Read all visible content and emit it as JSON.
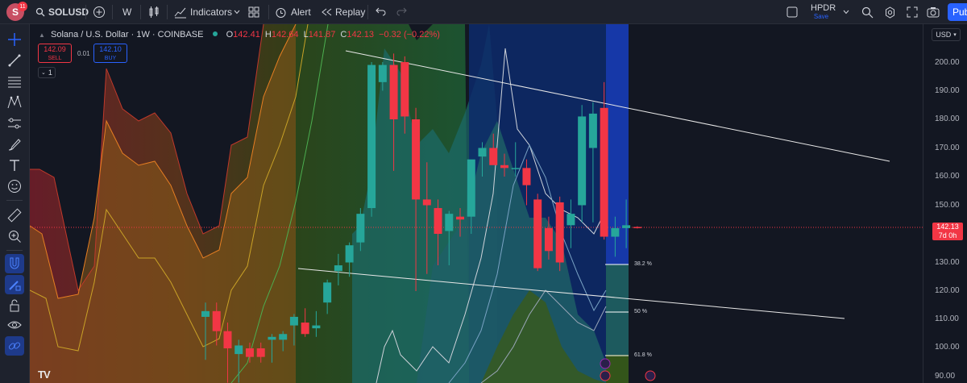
{
  "header": {
    "avatar_letter": "S",
    "notification_count": "11",
    "symbol": "SOLUSD",
    "interval": "W",
    "indicators_label": "Indicators",
    "alert_label": "Alert",
    "replay_label": "Replay",
    "layout_name": "HPDR",
    "layout_status": "Save",
    "publish_label": "Pub"
  },
  "legend": {
    "title": "Solana / U.S. Dollar · 1W · COINBASE",
    "o_label": "O",
    "o_value": "142.41",
    "h_label": "H",
    "h_value": "142.64",
    "l_label": "L",
    "l_value": "141.87",
    "c_label": "C",
    "c_value": "142.13",
    "change": "−0.32 (−0.22%)"
  },
  "trade": {
    "sell_price": "142.09",
    "sell_label": "SELL",
    "spread": "0.01",
    "buy_price": "142.10",
    "buy_label": "BUY",
    "indicator_count": "1"
  },
  "axis": {
    "currency": "USD",
    "ticks": [
      "200.00",
      "190.00",
      "180.00",
      "170.00",
      "160.00",
      "150.00",
      "130.00",
      "120.00",
      "110.00",
      "100.00",
      "90.00"
    ],
    "last_price": "142.13",
    "countdown": "7d 0h"
  },
  "fib_levels": [
    "38.2 %",
    "50 %",
    "61.8 %"
  ],
  "logo": "TV",
  "colors": {
    "background": "#131722",
    "up": "#26a69a",
    "down": "#f23645",
    "accent": "#2962ff"
  },
  "candles": [
    {
      "o": 111,
      "h": 116,
      "l": 96,
      "c": 113
    },
    {
      "o": 113,
      "h": 116,
      "l": 101,
      "c": 106
    },
    {
      "o": 106,
      "h": 109,
      "l": 88,
      "c": 100
    },
    {
      "o": 98,
      "h": 103,
      "l": 88,
      "c": 101
    },
    {
      "o": 100,
      "h": 102,
      "l": 95,
      "c": 97
    },
    {
      "o": 100,
      "h": 102,
      "l": 95,
      "c": 97
    },
    {
      "o": 103,
      "h": 105,
      "l": 95,
      "c": 104
    },
    {
      "o": 103,
      "h": 106,
      "l": 99,
      "c": 105
    },
    {
      "o": 108,
      "h": 112,
      "l": 101,
      "c": 111
    },
    {
      "o": 109,
      "h": 114,
      "l": 104,
      "c": 105
    },
    {
      "o": 107,
      "h": 113,
      "l": 104,
      "c": 108
    },
    {
      "o": 116,
      "h": 124,
      "l": 112,
      "c": 123
    },
    {
      "o": 127,
      "h": 133,
      "l": 122,
      "c": 129
    },
    {
      "o": 130,
      "h": 137,
      "l": 125,
      "c": 136
    },
    {
      "o": 137,
      "h": 149,
      "l": 134,
      "c": 147
    },
    {
      "o": 149,
      "h": 200,
      "l": 146,
      "c": 199
    },
    {
      "o": 193,
      "h": 200,
      "l": 190,
      "c": 199
    },
    {
      "o": 199,
      "h": 203,
      "l": 162,
      "c": 180
    },
    {
      "o": 200,
      "h": 202,
      "l": 175,
      "c": 181
    },
    {
      "o": 180,
      "h": 184,
      "l": 120,
      "c": 152
    },
    {
      "o": 152,
      "h": 165,
      "l": 126,
      "c": 150
    },
    {
      "o": 149,
      "h": 152,
      "l": 129,
      "c": 140
    },
    {
      "o": 141,
      "h": 148,
      "l": 129,
      "c": 147
    },
    {
      "o": 146,
      "h": 149,
      "l": 139,
      "c": 145
    },
    {
      "o": 146,
      "h": 154,
      "l": 140,
      "c": 166
    },
    {
      "o": 167,
      "h": 172,
      "l": 160,
      "c": 170
    },
    {
      "o": 170,
      "h": 175,
      "l": 166,
      "c": 164
    },
    {
      "o": 164,
      "h": 168,
      "l": 160,
      "c": 163
    },
    {
      "o": 163,
      "h": 172,
      "l": 160,
      "c": 163
    },
    {
      "o": 163,
      "h": 166,
      "l": 150,
      "c": 157
    },
    {
      "o": 152,
      "h": 154,
      "l": 127,
      "c": 128
    },
    {
      "o": 142,
      "h": 146,
      "l": 131,
      "c": 134
    },
    {
      "o": 151,
      "h": 153,
      "l": 127,
      "c": 130
    },
    {
      "o": 143,
      "h": 152,
      "l": 135,
      "c": 147
    },
    {
      "o": 150,
      "h": 185,
      "l": 144,
      "c": 181
    },
    {
      "o": 170,
      "h": 186,
      "l": 144,
      "c": 182
    },
    {
      "o": 184,
      "h": 193,
      "l": 138,
      "c": 139
    },
    {
      "o": 139,
      "h": 146,
      "l": 132,
      "c": 142
    },
    {
      "o": 142,
      "h": 152,
      "l": 135,
      "c": 143
    },
    {
      "o": 142.41,
      "h": 142.64,
      "l": 141.87,
      "c": 142.13
    }
  ]
}
